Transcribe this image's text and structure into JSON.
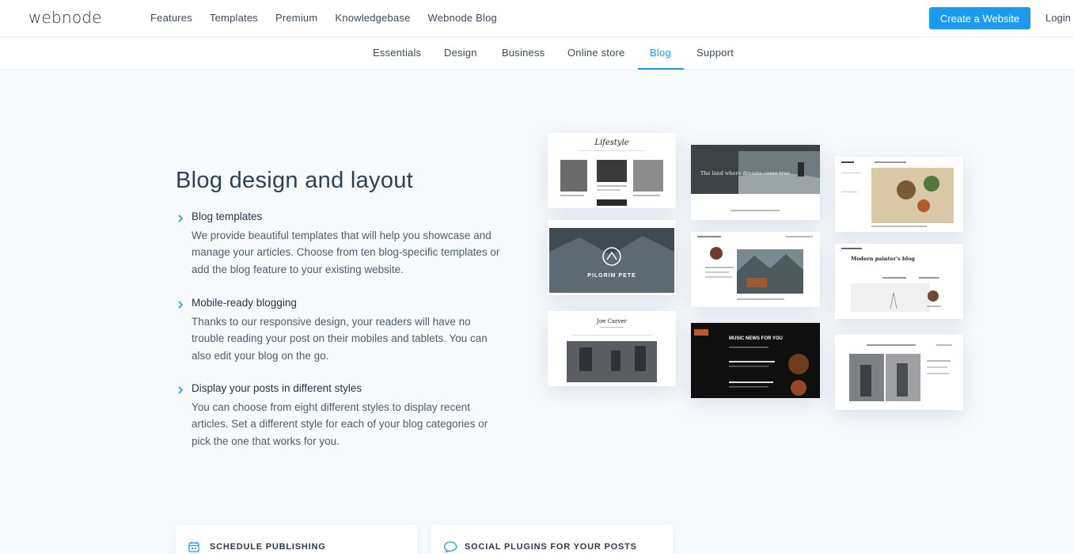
{
  "brand": {
    "logo_text": "webnode",
    "accent": "#1a9bf0"
  },
  "top_nav": {
    "items": [
      "Features",
      "Templates",
      "Premium",
      "Knowledgebase",
      "Webnode Blog"
    ],
    "cta_label": "Create a Website",
    "login_label": "Login"
  },
  "sub_nav": {
    "tabs": [
      "Essentials",
      "Design",
      "Business",
      "Online store",
      "Blog",
      "Support"
    ],
    "active": "Blog"
  },
  "main": {
    "heading": "Blog design and layout",
    "features": [
      {
        "title": "Blog templates",
        "description": "We provide beautiful templates that will help you showcase and manage your articles. Choose from ten blog-specific templates or add the blog feature to your existing website.",
        "icon": "chevron-right-icon"
      },
      {
        "title": "Mobile-ready blogging",
        "description": "Thanks to our responsive design, your readers will have no trouble reading your post on their mobiles and tablets. You can also edit your blog on the go.",
        "icon": "chevron-right-icon"
      },
      {
        "title": "Display your posts in different styles",
        "description": "You can choose from eight different styles to display recent articles. Set a different style for each of your blog categories or pick the one that works for you.",
        "icon": "chevron-right-icon"
      }
    ]
  },
  "templates": {
    "lifestyle_title": "Lifestyle",
    "land_text": "The land where dreams come true",
    "pilgrim_title": "PILGRIM PETE",
    "painter_title": "Modern painter's blog",
    "joe_title": "Joe Carver",
    "music_title": "MUSIC NEWS FOR YOU"
  },
  "cards": [
    {
      "title": "SCHEDULE PUBLISHING",
      "icon": "calendar-icon"
    },
    {
      "title": "SOCIAL PLUGINS FOR YOUR POSTS",
      "icon": "speech-bubble-icon"
    }
  ]
}
